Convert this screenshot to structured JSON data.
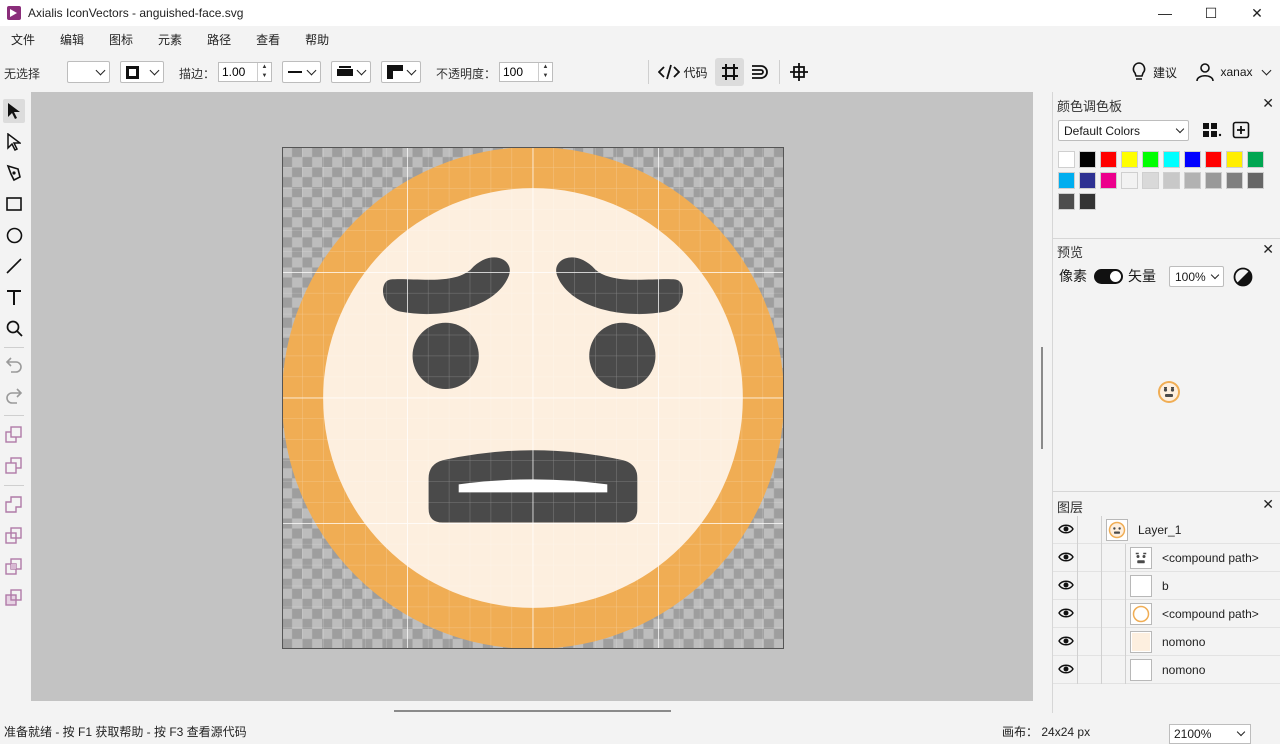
{
  "window": {
    "title": "Axialis IconVectors - anguished-face.svg",
    "minimize": "—",
    "maximize": "☐",
    "close": "✕"
  },
  "menu": [
    "文件",
    "编辑",
    "图标",
    "元素",
    "路径",
    "查看",
    "帮助"
  ],
  "toolbar": {
    "selection_label": "无选择",
    "stroke_label": "描边：",
    "stroke_value": "1.00",
    "opacity_label": "不透明度：",
    "opacity_value": "100",
    "code_label": "代码",
    "suggest_label": "建议",
    "user_name": "xanax"
  },
  "palette": {
    "title": "颜色调色板",
    "set_name": "Default Colors",
    "swatches": [
      "#ffffff",
      "#000000",
      "#ff0000",
      "#ffff00",
      "#00ff00",
      "#00ffff",
      "#0000ff",
      "#ff0000",
      "#ffee00",
      "#00a651",
      "#00aeef",
      "#2e3192",
      "#ec008c",
      "#f2f2f2",
      "#d9d9d9",
      "#c8c8c8",
      "#b2b2b2",
      "#999999",
      "#7f7f7f",
      "#666666",
      "#4d4d4d",
      "#333333"
    ]
  },
  "preview": {
    "title": "预览",
    "pixel_label": "像素",
    "vector_label": "矢量",
    "zoom_value": "100%"
  },
  "layers": {
    "title": "图层",
    "items": [
      {
        "name": "Layer_1",
        "level": 0
      },
      {
        "name": "<compound path>",
        "level": 1
      },
      {
        "name": "b",
        "level": 1
      },
      {
        "name": "<compound path>",
        "level": 1
      },
      {
        "name": "nomono",
        "level": 1
      },
      {
        "name": "nomono",
        "level": 1
      }
    ]
  },
  "status": {
    "message": "准备就绪 - 按 F1 获取帮助 - 按 F3 查看源代码",
    "canvas_label": "画布：",
    "canvas_size": "24x24 px",
    "zoom": "2100%"
  },
  "colors": {
    "face_ring": "#f0ad54",
    "face_fill": "#fdefdf",
    "features": "#4a4a4a",
    "teeth": "#ffffff",
    "canvas_bg": "#c3c3c3"
  }
}
